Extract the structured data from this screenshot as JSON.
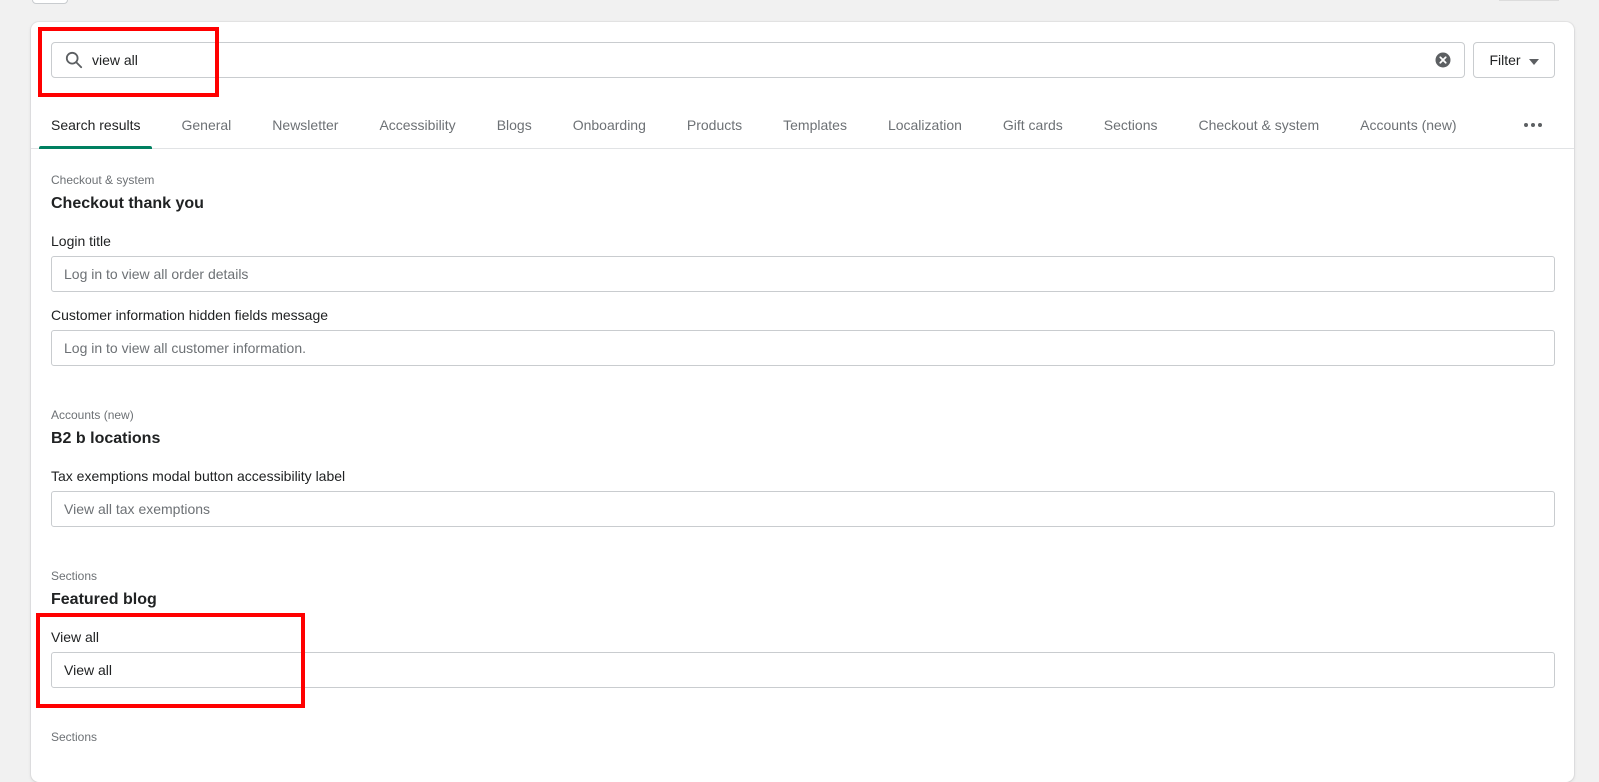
{
  "search": {
    "value": "view all",
    "filter_label": "Filter"
  },
  "tabs": [
    {
      "label": "Search results",
      "active": true
    },
    {
      "label": "General"
    },
    {
      "label": "Newsletter"
    },
    {
      "label": "Accessibility"
    },
    {
      "label": "Blogs"
    },
    {
      "label": "Onboarding"
    },
    {
      "label": "Products"
    },
    {
      "label": "Templates"
    },
    {
      "label": "Localization"
    },
    {
      "label": "Gift cards"
    },
    {
      "label": "Sections"
    },
    {
      "label": "Checkout & system"
    },
    {
      "label": "Accounts (new)"
    }
  ],
  "results": [
    {
      "category": "Checkout & system",
      "title": "Checkout thank you",
      "fields": [
        {
          "label": "Login title",
          "placeholder": "Log in to view all order details"
        },
        {
          "label": "Customer information hidden fields message",
          "placeholder": "Log in to view all customer information."
        }
      ]
    },
    {
      "category": "Accounts (new)",
      "title": "B2 b locations",
      "fields": [
        {
          "label": "Tax exemptions modal button accessibility label",
          "placeholder": "View all tax exemptions"
        }
      ]
    },
    {
      "category": "Sections",
      "title": "Featured blog",
      "fields": [
        {
          "label": "View all",
          "value": "View all"
        }
      ]
    },
    {
      "category": "Sections"
    }
  ],
  "colors": {
    "accent": "#008060",
    "highlight": "#ff0000"
  }
}
